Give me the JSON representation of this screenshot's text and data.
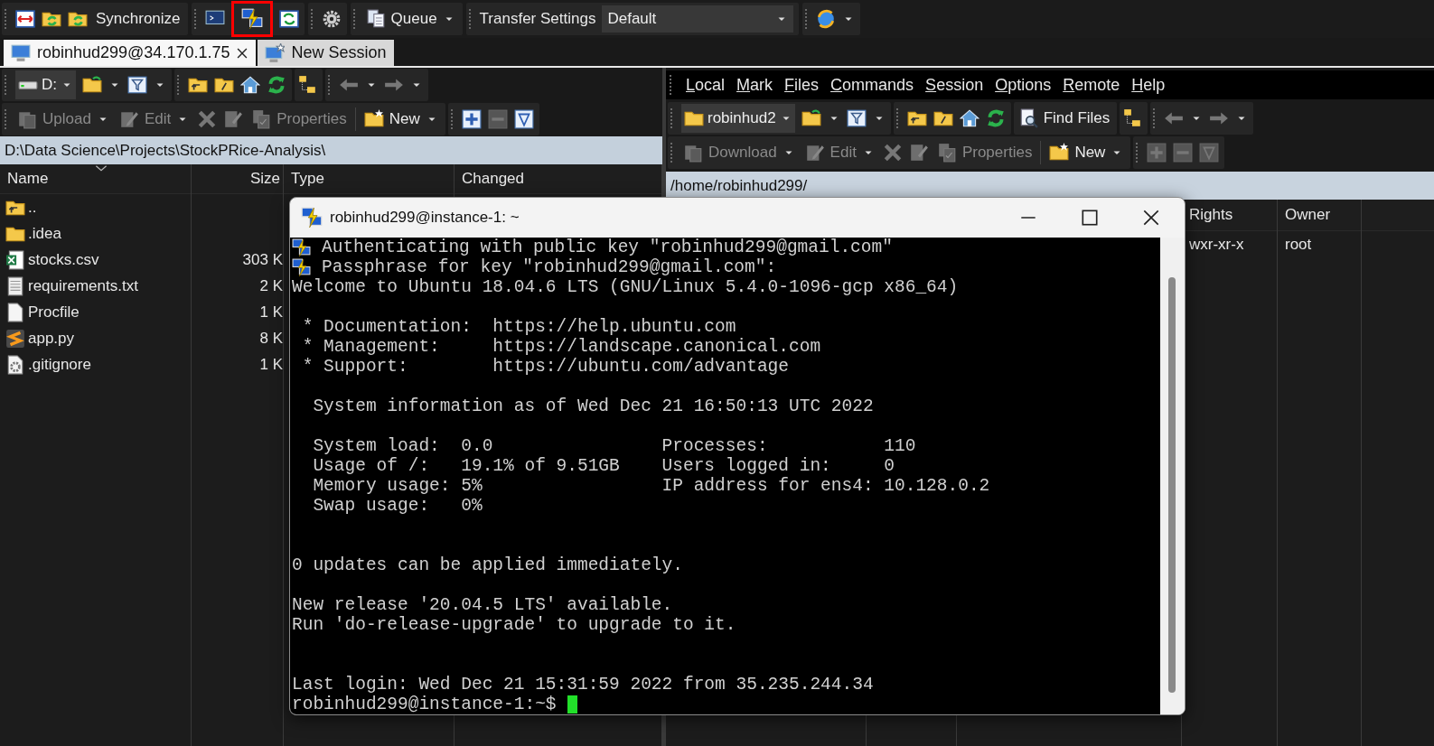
{
  "toolbar": {
    "synchronize": "Synchronize",
    "queue": "Queue",
    "transfer_settings_label": "Transfer Settings",
    "transfer_settings_value": "Default",
    "putty_icon_highlighted": true
  },
  "session_tabs": [
    {
      "label": "robinhud299@34.170.1.75",
      "selected": true,
      "kind": "session"
    },
    {
      "label": "New Session",
      "selected": false,
      "kind": "new"
    }
  ],
  "local_panel": {
    "drive": "D:",
    "buttons": [
      {
        "kind": "upload",
        "label": "Upload",
        "disabled": true
      },
      {
        "kind": "edit",
        "label": "Edit",
        "disabled": true
      },
      {
        "kind": "properties",
        "label": "Properties",
        "disabled": true
      },
      {
        "kind": "new",
        "label": "New",
        "disabled": false
      }
    ],
    "path": "D:\\Data Science\\Projects\\StockPRice-Analysis\\",
    "columns": [
      "Name",
      "Size",
      "Type",
      "Changed"
    ],
    "files": [
      {
        "kind": "parent",
        "name": ".."
      },
      {
        "kind": "folder",
        "name": ".idea"
      },
      {
        "kind": "spreadsheet",
        "name": "stocks.csv",
        "size": "303 K"
      },
      {
        "kind": "text",
        "name": "requirements.txt",
        "size": "2 K"
      },
      {
        "kind": "file",
        "name": "Procfile",
        "size": "1 K"
      },
      {
        "kind": "python",
        "name": "app.py",
        "size": "8 K"
      },
      {
        "kind": "config",
        "name": ".gitignore",
        "size": "1 K"
      }
    ]
  },
  "remote_panel": {
    "menu": [
      "Local",
      "Mark",
      "Files",
      "Commands",
      "Session",
      "Options",
      "Remote",
      "Help"
    ],
    "directory": "robinhud2",
    "find_files": "Find Files",
    "buttons": [
      {
        "kind": "download",
        "label": "Download",
        "disabled": true
      },
      {
        "kind": "edit",
        "label": "Edit",
        "disabled": true
      },
      {
        "kind": "properties",
        "label": "Properties",
        "disabled": true
      },
      {
        "kind": "new",
        "label": "New",
        "disabled": false
      }
    ],
    "path": "/home/robinhud299/",
    "columns": [
      "Rights",
      "Owner"
    ],
    "rows": [
      {
        "rights": "wxr-xr-x",
        "owner": "root"
      }
    ]
  },
  "terminal": {
    "title": "robinhud299@instance-1: ~",
    "lines": [
      {
        "kind": "notice",
        "text": "Authenticating with public key \"robinhud299@gmail.com\""
      },
      {
        "kind": "notice",
        "text": "Passphrase for key \"robinhud299@gmail.com\":"
      },
      {
        "kind": "plain",
        "text": "Welcome to Ubuntu 18.04.6 LTS (GNU/Linux 5.4.0-1096-gcp x86_64)"
      },
      {
        "kind": "blank"
      },
      {
        "kind": "plain",
        "text": " * Documentation:  https://help.ubuntu.com"
      },
      {
        "kind": "plain",
        "text": " * Management:     https://landscape.canonical.com"
      },
      {
        "kind": "plain",
        "text": " * Support:        https://ubuntu.com/advantage"
      },
      {
        "kind": "blank"
      },
      {
        "kind": "plain",
        "text": "  System information as of Wed Dec 21 16:50:13 UTC 2022"
      },
      {
        "kind": "blank"
      },
      {
        "kind": "plain",
        "text": "  System load:  0.0                Processes:           110"
      },
      {
        "kind": "plain",
        "text": "  Usage of /:   19.1% of 9.51GB    Users logged in:     0"
      },
      {
        "kind": "plain",
        "text": "  Memory usage: 5%                 IP address for ens4: 10.128.0.2"
      },
      {
        "kind": "plain",
        "text": "  Swap usage:   0%"
      },
      {
        "kind": "blank"
      },
      {
        "kind": "blank"
      },
      {
        "kind": "plain",
        "text": "0 updates can be applied immediately."
      },
      {
        "kind": "blank"
      },
      {
        "kind": "plain",
        "text": "New release '20.04.5 LTS' available."
      },
      {
        "kind": "plain",
        "text": "Run 'do-release-upgrade' to upgrade to it."
      },
      {
        "kind": "blank"
      },
      {
        "kind": "blank"
      },
      {
        "kind": "plain",
        "text": "Last login: Wed Dec 21 15:31:59 2022 from 35.235.244.34"
      },
      {
        "kind": "prompt",
        "text": "robinhud299@instance-1:~$"
      }
    ]
  }
}
